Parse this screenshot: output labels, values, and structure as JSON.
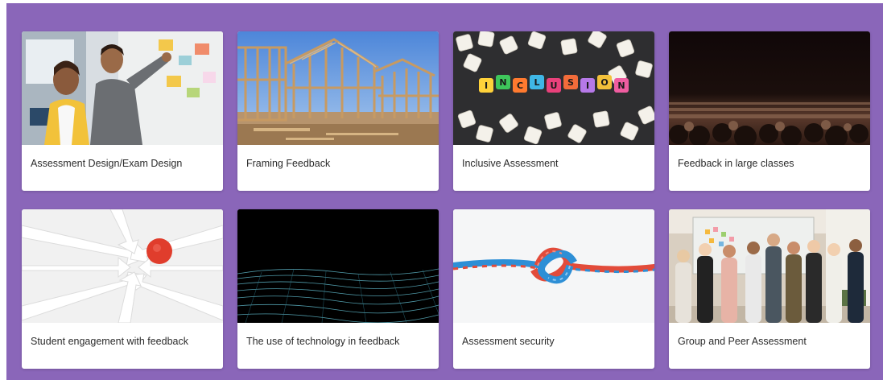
{
  "cards": [
    {
      "title": "Assessment Design/Exam Design",
      "image": "people-at-whiteboard"
    },
    {
      "title": "Framing Feedback",
      "image": "house-timber-framing"
    },
    {
      "title": "Inclusive Assessment",
      "image": "inclusion-letter-dice",
      "word": "INCLUSION"
    },
    {
      "title": "Feedback in large classes",
      "image": "large-crowd"
    },
    {
      "title": "Student engagement with feedback",
      "image": "arrows-converging-on-red-dot"
    },
    {
      "title": "The use of technology in feedback",
      "image": "digital-wave-particles"
    },
    {
      "title": "Assessment security",
      "image": "rope-knot"
    },
    {
      "title": "Group and Peer Assessment",
      "image": "group-meeting-whiteboard"
    }
  ],
  "colors": {
    "background": "#8a66b9",
    "card": "#ffffff",
    "text": "#2b2b2b"
  }
}
